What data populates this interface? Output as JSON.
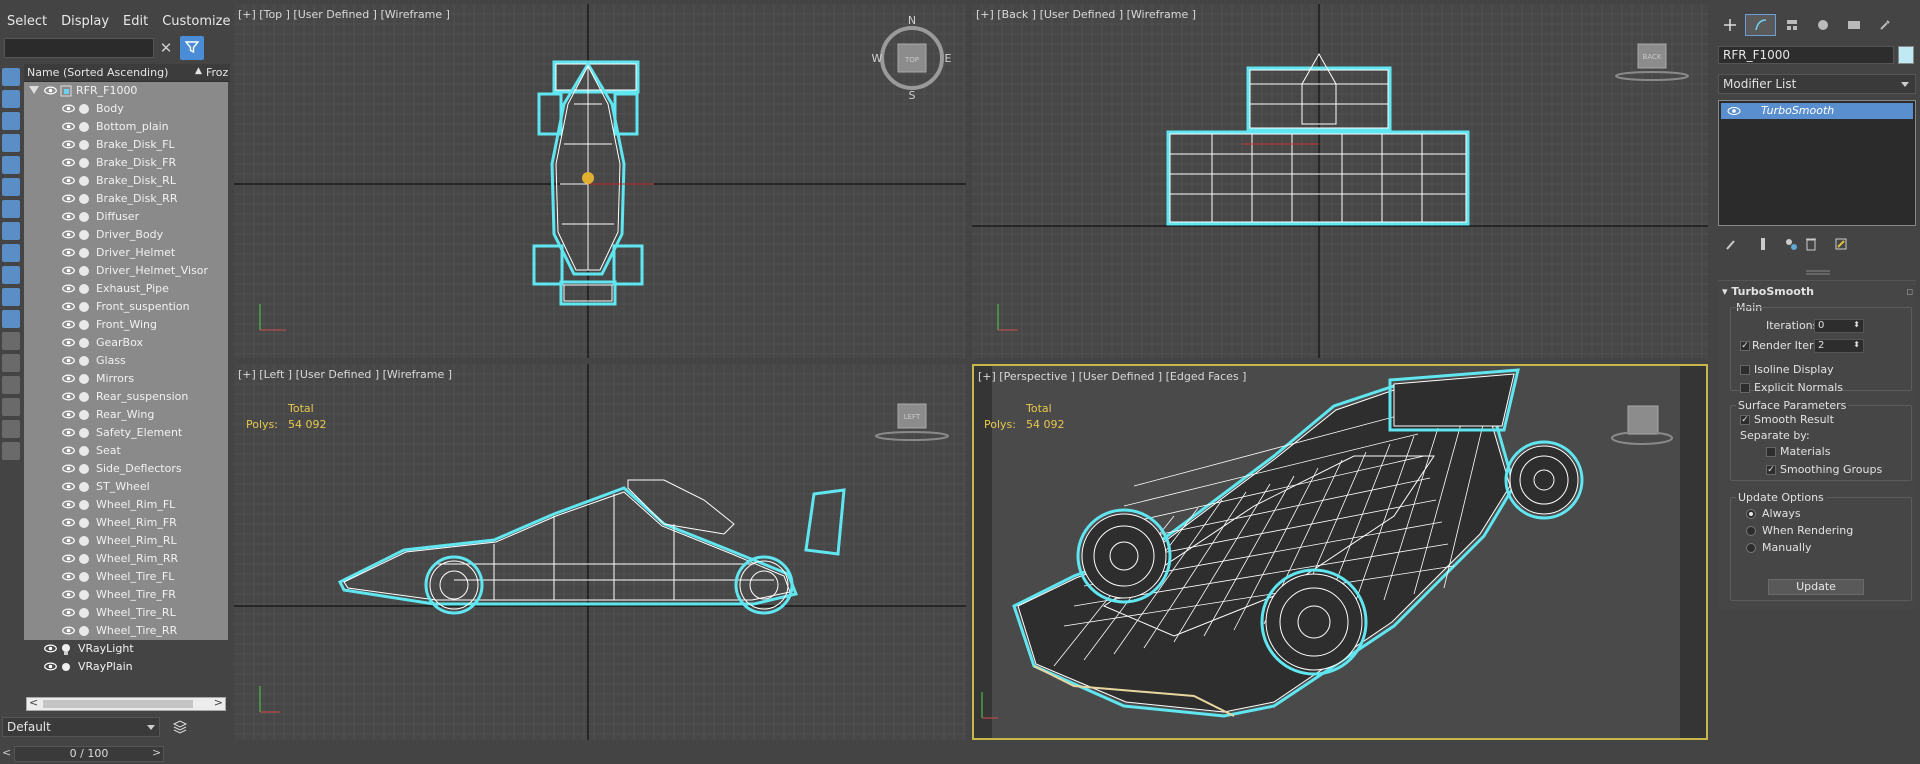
{
  "menu": [
    "Select",
    "Display",
    "Edit",
    "Customize"
  ],
  "scene_explorer": {
    "column_name": "Name (Sorted Ascending)",
    "column_frozen": "Froz",
    "root": "RFR_F1000",
    "children": [
      "Body",
      "Bottom_plain",
      "Brake_Disk_FL",
      "Brake_Disk_FR",
      "Brake_Disk_RL",
      "Brake_Disk_RR",
      "Diffuser",
      "Driver_Body",
      "Driver_Helmet",
      "Driver_Helmet_Visor",
      "Exhaust_Pipe",
      "Front_suspention",
      "Front_Wing",
      "GearBox",
      "Glass",
      "Mirrors",
      "Rear_suspension",
      "Rear_Wing",
      "Safety_Element",
      "Seat",
      "Side_Deflectors",
      "ST_Wheel",
      "Wheel_Rim_FL",
      "Wheel_Rim_FR",
      "Wheel_Rim_RL",
      "Wheel_Rim_RR",
      "Wheel_Tire_FL",
      "Wheel_Tire_FR",
      "Wheel_Tire_RL",
      "Wheel_Tire_RR"
    ],
    "others": [
      "VRayLight",
      "VRayPlain"
    ],
    "layer": "Default",
    "timeline": "0 / 100"
  },
  "viewports": {
    "top": {
      "label": "[+] [Top ] [User Defined ] [Wireframe ]",
      "cube": "TOP",
      "compass": [
        "N",
        "E",
        "S",
        "W"
      ]
    },
    "back": {
      "label": "[+] [Back ] [User Defined ] [Wireframe ]",
      "cube": "BACK"
    },
    "left": {
      "label": "[+] [Left ] [User Defined ] [Wireframe ]",
      "cube": "LEFT",
      "stat_total": "Total",
      "stat_polys_label": "Polys:",
      "stat_polys": "54 092"
    },
    "persp": {
      "label": "[+] [Perspective ] [User Defined ] [Edged Faces ]",
      "stat_total": "Total",
      "stat_polys_label": "Polys:",
      "stat_polys": "54 092"
    }
  },
  "command_panel": {
    "object_name": "RFR_F1000",
    "object_color": "#bfe9f3",
    "modifier_list": "Modifier List",
    "stack_item": "TurboSmooth",
    "rollout_title": "TurboSmooth",
    "main_label": "Main",
    "iterations_label": "Iterations:",
    "iterations_value": "0",
    "render_iters_label": "Render Iters:",
    "render_iters_value": "2",
    "isoline_label": "Isoline Display",
    "explicit_label": "Explicit Normals",
    "surface_label": "Surface Parameters",
    "smooth_result_label": "Smooth Result",
    "separate_label": "Separate by:",
    "materials_label": "Materials",
    "smoothing_groups_label": "Smoothing Groups",
    "update_options_label": "Update Options",
    "always_label": "Always",
    "when_rendering_label": "When Rendering",
    "manually_label": "Manually",
    "update_button": "Update"
  },
  "colors": {
    "selection_cyan": "#5fe6f0",
    "active_border": "#c7b64a",
    "accent_blue": "#5a8fcf"
  }
}
